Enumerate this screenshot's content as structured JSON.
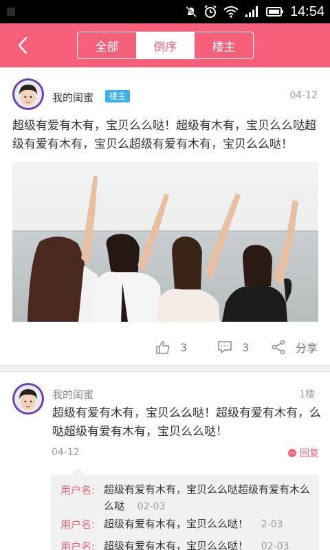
{
  "status_bar": {
    "time": "14:54",
    "icons": [
      "mute-icon",
      "alarm-icon",
      "wifi-icon",
      "signal-icon",
      "battery-icon"
    ]
  },
  "header": {
    "tabs": [
      {
        "label": "全部",
        "active": false
      },
      {
        "label": "倒序",
        "active": true
      },
      {
        "label": "楼主",
        "active": false
      }
    ],
    "accent_color": "#f6607a"
  },
  "post": {
    "author": "我的闺蜜",
    "badge": "楼主",
    "date": "04-12",
    "content": "超级有爱有木有，宝贝么么哒！超级有木有，宝贝么么哒超级有爱有木有，宝贝么超级有爱有木有，宝贝么么哒！",
    "likes": "3",
    "comments": "3",
    "share_label": "分享"
  },
  "reply": {
    "author": "我的闺蜜",
    "floor": "1楼",
    "content": "超级有爱有木有，宝贝么么哒！超级有爱有木有，么哒超级有爱有木有，宝贝么么哒！",
    "date": "04-12",
    "reply_label": "回复",
    "sub_replies": [
      {
        "user": "用户名:",
        "text": "超级有爱有木有，宝贝么么哒超级有爱有木么么哒",
        "date": "02-03"
      },
      {
        "user": "用户名:",
        "text": "超级有爱有木有，宝贝么么哒！",
        "date": "2-03"
      },
      {
        "user": "用户名:",
        "text": "超级有爱有木有，宝贝么么哒！",
        "date": "02-03"
      }
    ]
  }
}
